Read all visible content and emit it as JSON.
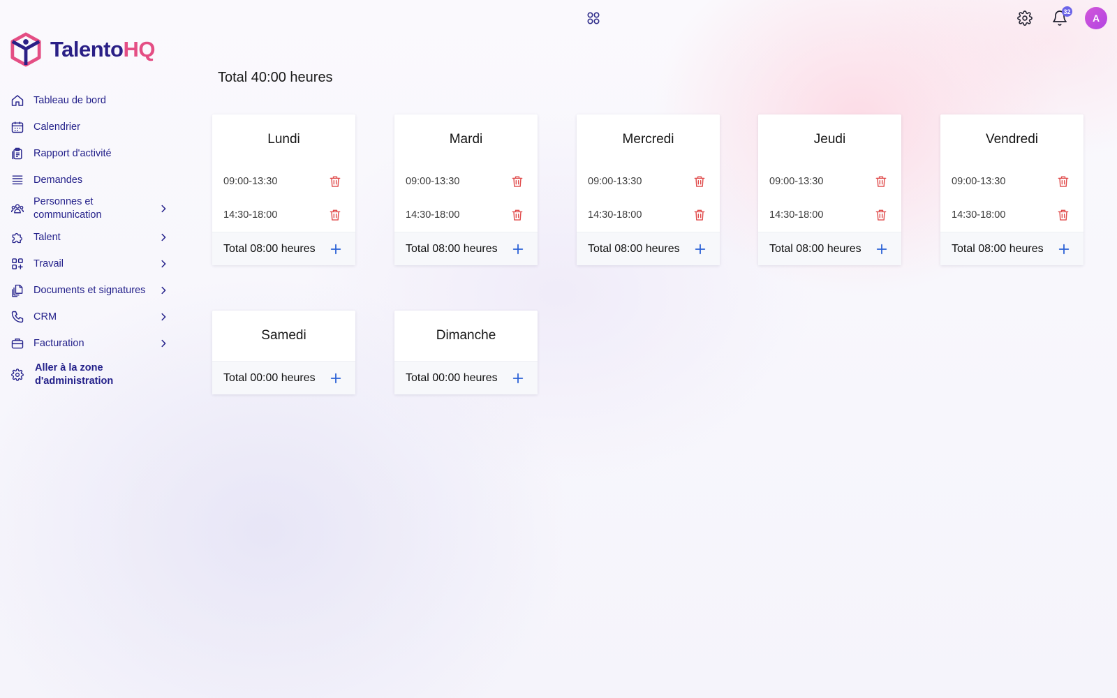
{
  "app": {
    "logo_part1": "Talento",
    "logo_part2": "HQ"
  },
  "topbar": {
    "notifications_count": "32",
    "avatar_initial": "A"
  },
  "sidebar": {
    "items": [
      {
        "label": "Tableau de bord",
        "icon": "home-icon"
      },
      {
        "label": "Calendrier",
        "icon": "calendar-icon"
      },
      {
        "label": "Rapport d'activité",
        "icon": "report-icon"
      },
      {
        "label": "Demandes",
        "icon": "stack-icon"
      },
      {
        "label": "Personnes et communication",
        "icon": "people-icon",
        "expandable": true
      },
      {
        "label": "Talent",
        "icon": "puzzle-icon",
        "expandable": true
      },
      {
        "label": "Travail",
        "icon": "grid-plus-icon",
        "expandable": true
      },
      {
        "label": "Documents et signatures",
        "icon": "documents-icon",
        "expandable": true
      },
      {
        "label": "CRM",
        "icon": "phone-icon",
        "expandable": true
      },
      {
        "label": "Facturation",
        "icon": "briefcase-icon",
        "expandable": true
      },
      {
        "label": "Aller à la zone d'administration",
        "icon": "gear-icon"
      }
    ]
  },
  "main": {
    "grand_total": "Total 40:00 heures",
    "days": [
      {
        "name": "Lundi",
        "slots": [
          "09:00-13:30",
          "14:30-18:00"
        ],
        "total": "Total 08:00 heures"
      },
      {
        "name": "Mardi",
        "slots": [
          "09:00-13:30",
          "14:30-18:00"
        ],
        "total": "Total 08:00 heures"
      },
      {
        "name": "Mercredi",
        "slots": [
          "09:00-13:30",
          "14:30-18:00"
        ],
        "total": "Total 08:00 heures"
      },
      {
        "name": "Jeudi",
        "slots": [
          "09:00-13:30",
          "14:30-18:00"
        ],
        "total": "Total 08:00 heures"
      },
      {
        "name": "Vendredi",
        "slots": [
          "09:00-13:30",
          "14:30-18:00"
        ],
        "total": "Total 08:00 heures"
      },
      {
        "name": "Samedi",
        "slots": [],
        "total": "Total 00:00 heures"
      },
      {
        "name": "Dimanche",
        "slots": [],
        "total": "Total 00:00 heures"
      }
    ]
  },
  "colors": {
    "brand_dark": "#2a1f86",
    "brand_pink": "#e44e84",
    "delete": "#e04b4b",
    "add": "#2b61d6"
  }
}
